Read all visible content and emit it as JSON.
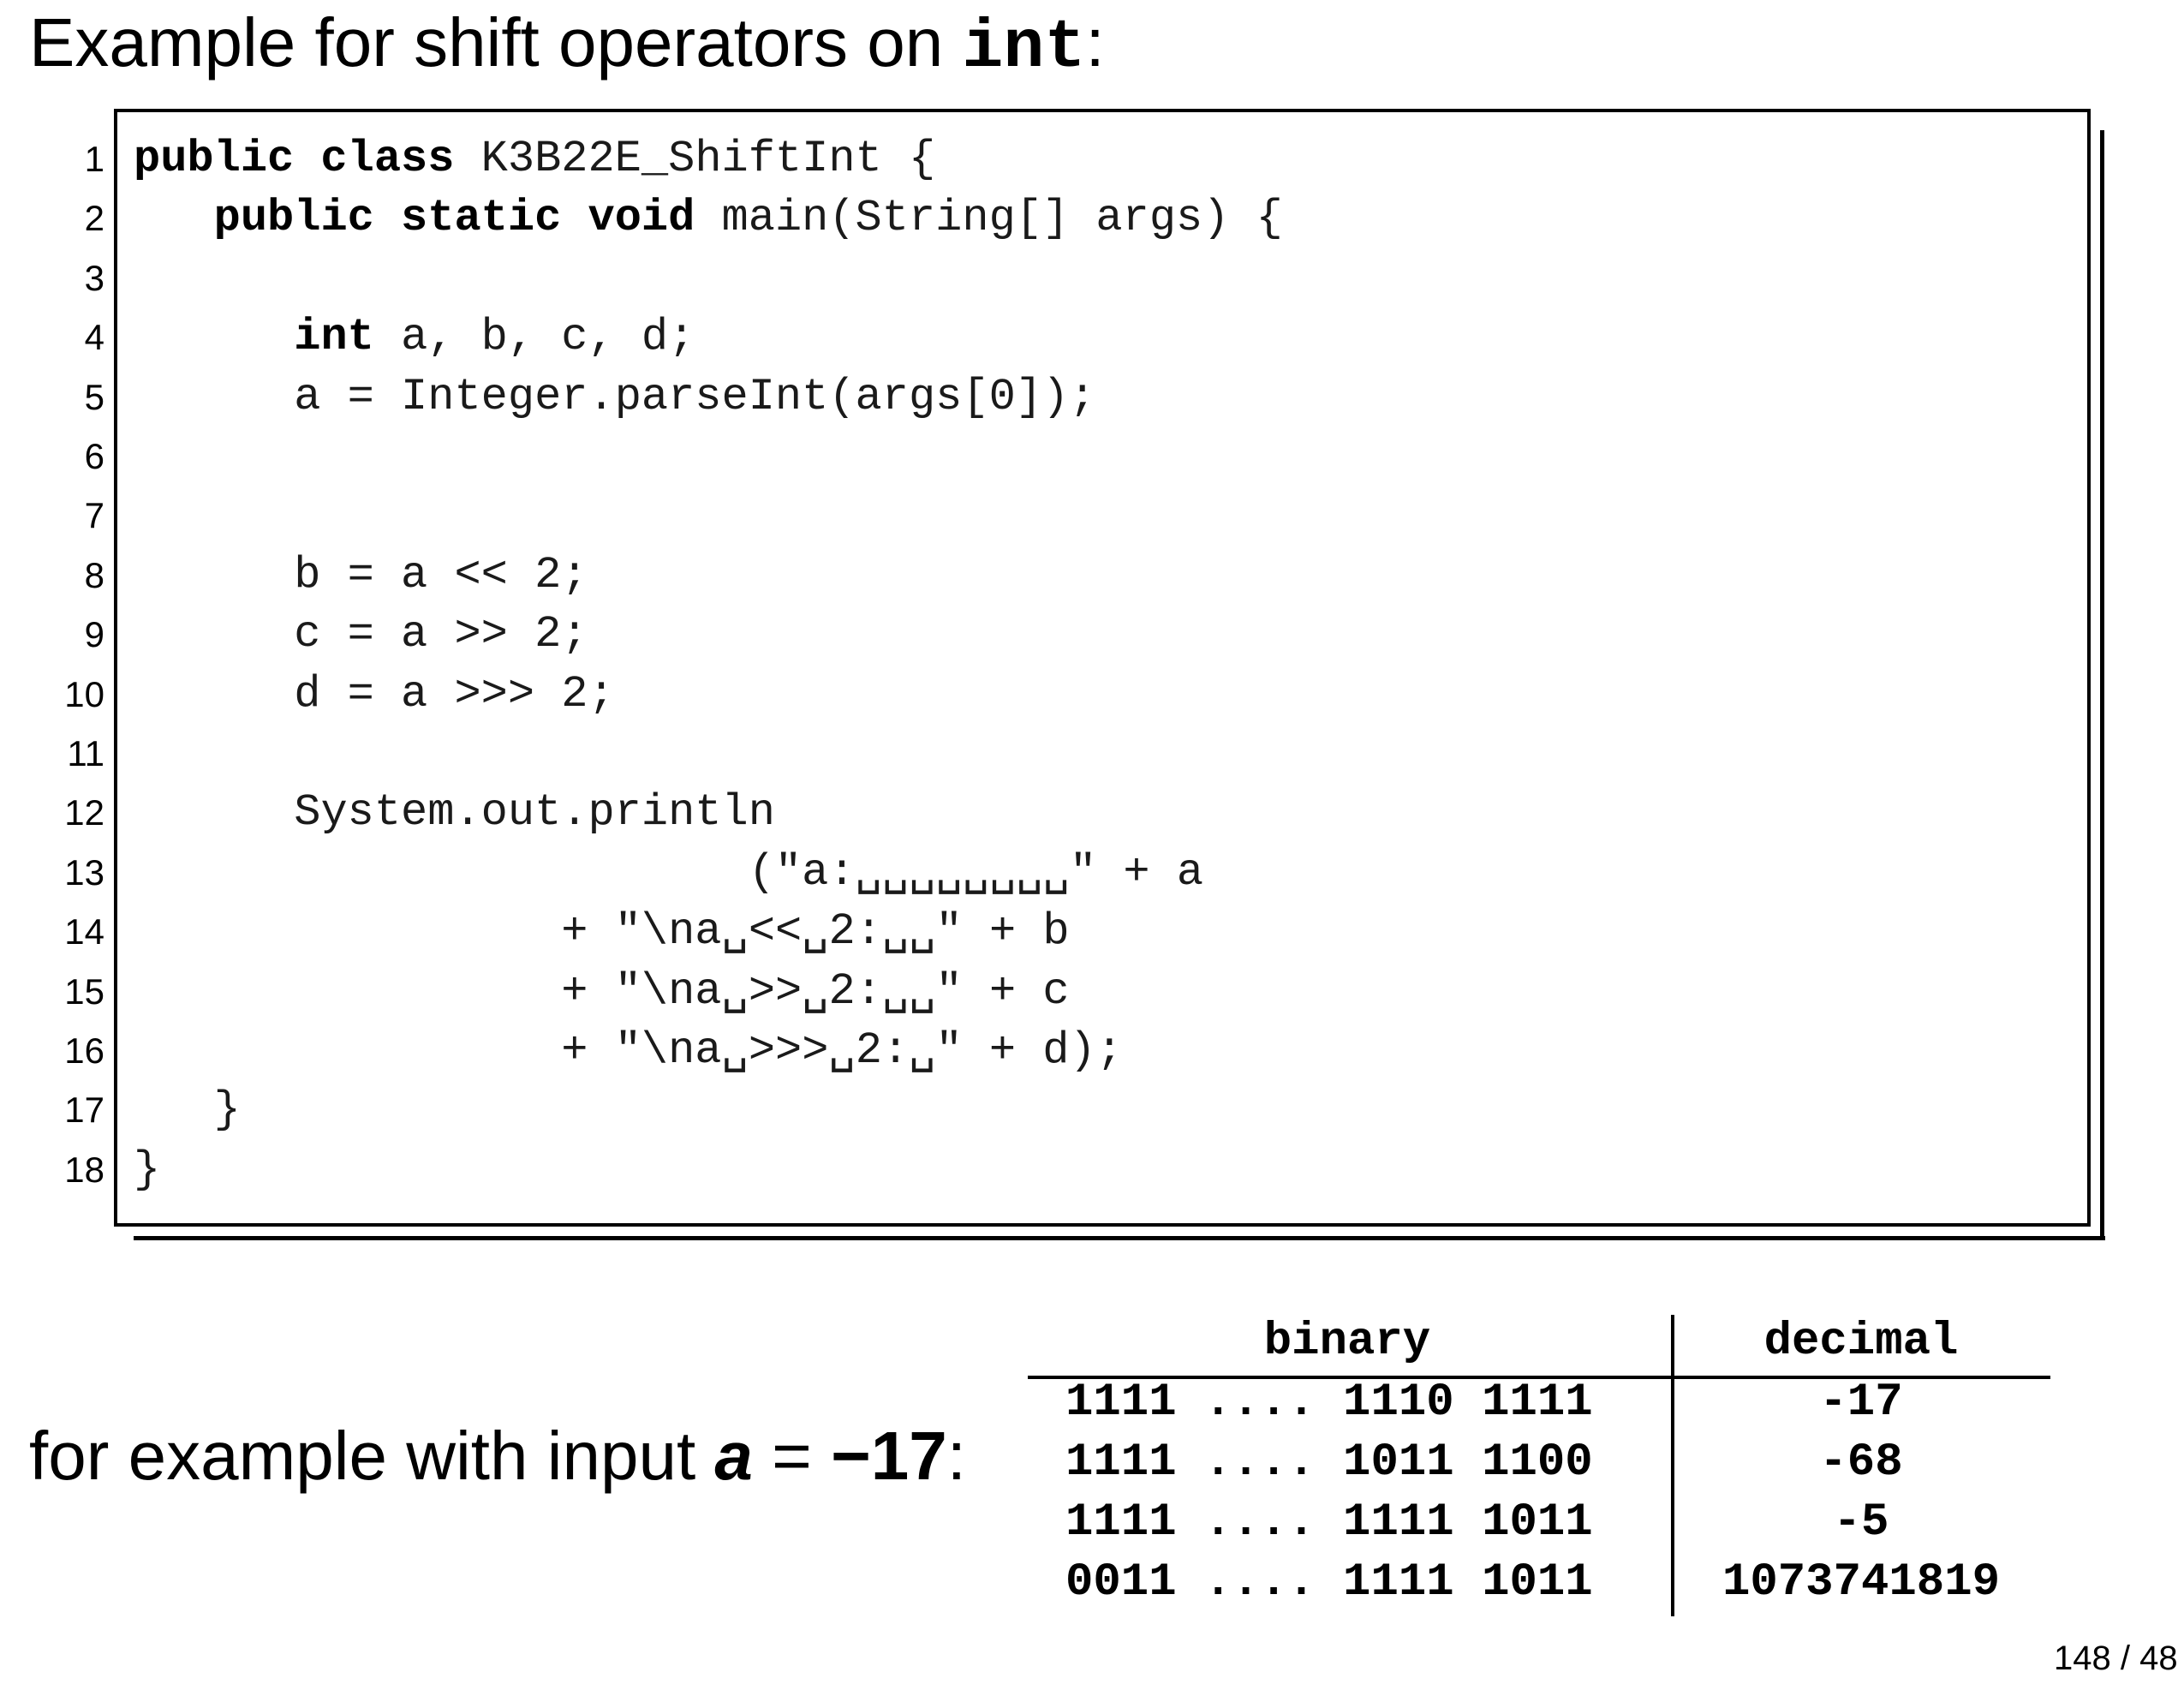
{
  "slide": {
    "title_prefix": "Example for shift operators on ",
    "title_keyword": "int",
    "title_suffix": ":"
  },
  "code_lines": [
    {
      "n": "1",
      "kw": "public class",
      "rest": " K3B22E_ShiftInt {"
    },
    {
      "n": "2",
      "indent": "   ",
      "kw": "public static void",
      "rest": " main(String[] args) {"
    },
    {
      "n": "3",
      "rest": ""
    },
    {
      "n": "4",
      "indent": "      ",
      "kw": "int",
      "rest": " a, b, c, d;"
    },
    {
      "n": "5",
      "indent": "      ",
      "rest": "a = Integer.parseInt(args[0]);"
    },
    {
      "n": "6",
      "rest": ""
    },
    {
      "n": "7",
      "rest": ""
    },
    {
      "n": "8",
      "indent": "      ",
      "rest": "b = a << 2;"
    },
    {
      "n": "9",
      "indent": "      ",
      "rest": "c = a >> 2;"
    },
    {
      "n": "10",
      "indent": "      ",
      "rest": "d = a >>> 2;"
    },
    {
      "n": "11",
      "rest": ""
    },
    {
      "n": "12",
      "indent": "      ",
      "rest": "System.out.println"
    },
    {
      "n": "13",
      "indent": "                       ",
      "rest": "(\"a:␣␣␣␣␣␣␣␣\" + a"
    },
    {
      "n": "14",
      "indent": "                ",
      "rest": "+ \"\\na␣<<␣2:␣␣\" + b"
    },
    {
      "n": "15",
      "indent": "                ",
      "rest": "+ \"\\na␣>>␣2:␣␣\" + c"
    },
    {
      "n": "16",
      "indent": "                ",
      "rest": "+ \"\\na␣>>>␣2:␣\" + d);"
    },
    {
      "n": "17",
      "indent": "   ",
      "rest": "}"
    },
    {
      "n": "18",
      "rest": "}"
    }
  ],
  "example": {
    "prefix": "for example with input ",
    "variable": "a",
    "equals": " = ",
    "value": "−17",
    "suffix": ":"
  },
  "table": {
    "headers": {
      "binary": "binary",
      "decimal": "decimal"
    },
    "rows": [
      {
        "binary": "1111 .... 1110 1111",
        "decimal": "-17"
      },
      {
        "binary": "1111 .... 1011 1100",
        "decimal": "-68"
      },
      {
        "binary": "1111 .... 1111 1011",
        "decimal": "-5"
      },
      {
        "binary": "0011 .... 1111 1011",
        "decimal": "1073741819"
      }
    ]
  },
  "page_number": "148 / 48"
}
